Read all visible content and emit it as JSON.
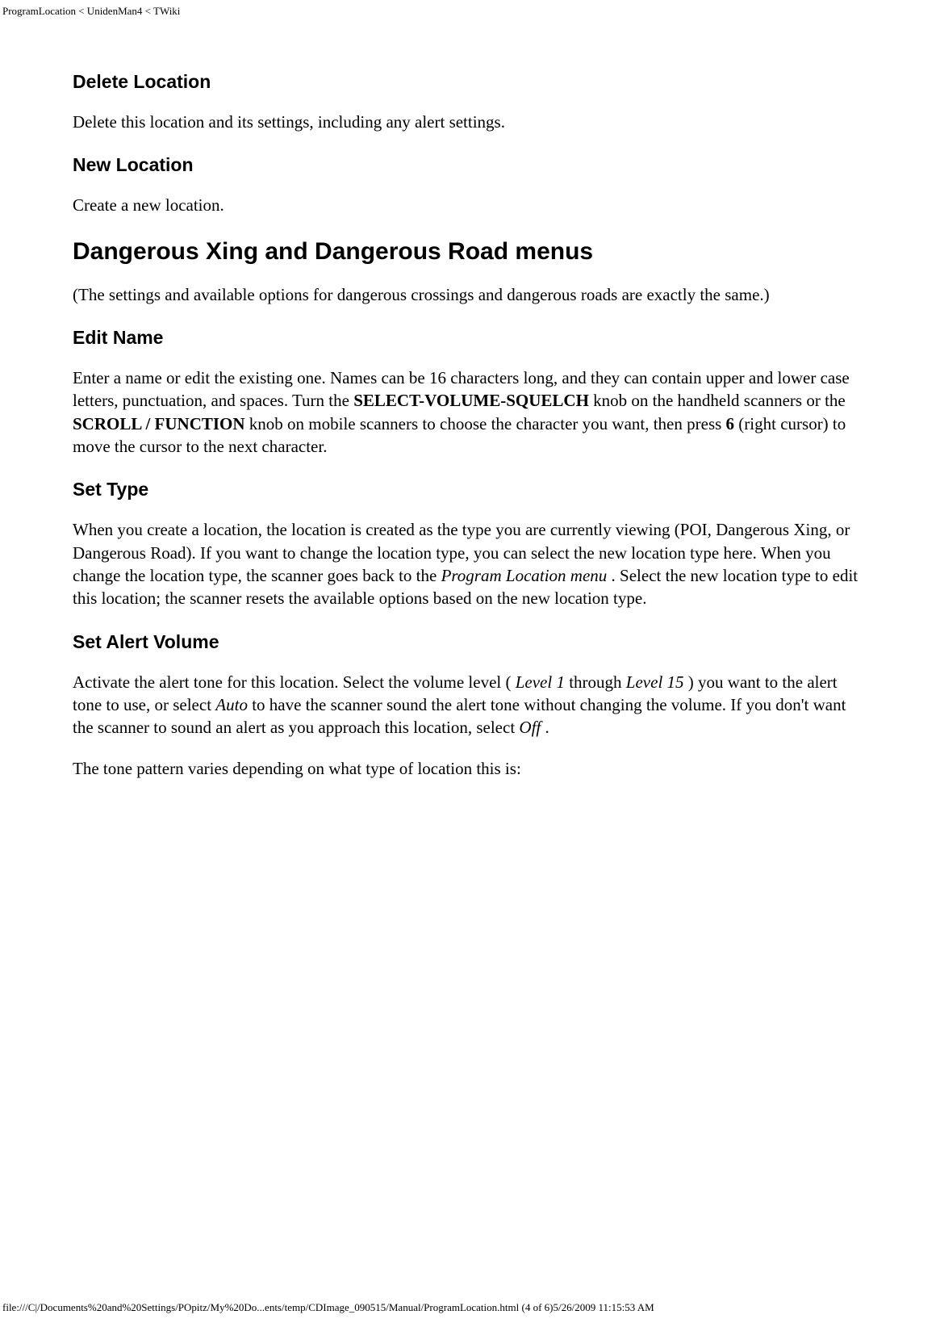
{
  "header": {
    "breadcrumb": "ProgramLocation < UnidenMan4 < TWiki"
  },
  "sections": {
    "deleteLocation": {
      "title": "Delete Location",
      "body": "Delete this location and its settings, including any alert settings."
    },
    "newLocation": {
      "title": "New Location",
      "body": "Create a new location."
    },
    "dangerousMenus": {
      "title": "Dangerous Xing and Dangerous Road menus",
      "intro": "(The settings and available options for dangerous crossings and dangerous roads are exactly the same.)"
    },
    "editName": {
      "title": "Edit Name",
      "body_pre": "Enter a name or edit the existing one. Names can be 16 characters long, and they can contain upper and lower case letters, punctuation, and spaces. Turn the ",
      "bold1": "SELECT-VOLUME-SQUELCH",
      "body_mid1": " knob on the handheld scanners or the ",
      "bold2": "SCROLL / FUNCTION",
      "body_mid2": " knob on mobile scanners to choose the character you want, then press ",
      "bold3": "6",
      "body_post": " (right cursor) to move the cursor to the next character."
    },
    "setType": {
      "title": "Set Type",
      "body_pre": "When you create a location, the location is created as the type you are currently viewing (POI, Dangerous Xing, or Dangerous Road). If you want to change the location type, you can select the new location type here. When you change the location type, the scanner goes back to the ",
      "italic1": "Program Location menu",
      "body_post": " . Select the new location type to edit this location; the scanner resets the available options based on the new location type."
    },
    "setAlertVolume": {
      "title": "Set Alert Volume",
      "p1_pre": "Activate the alert tone for this location. Select the volume level ( ",
      "p1_i1": "Level 1",
      "p1_mid1": " through ",
      "p1_i2": "Level 15",
      "p1_mid2": " ) you want to the alert tone to use, or select ",
      "p1_i3": "Auto",
      "p1_mid3": " to have the scanner sound the alert tone without changing the volume. If you don't want the scanner to sound an alert as you approach this location, select ",
      "p1_i4": "Off",
      "p1_post": " .",
      "p2": "The tone pattern varies depending on what type of location this is:"
    }
  },
  "footer": {
    "text": "file:///C|/Documents%20and%20Settings/POpitz/My%20Do...ents/temp/CDImage_090515/Manual/ProgramLocation.html (4 of 6)5/26/2009 11:15:53 AM"
  }
}
